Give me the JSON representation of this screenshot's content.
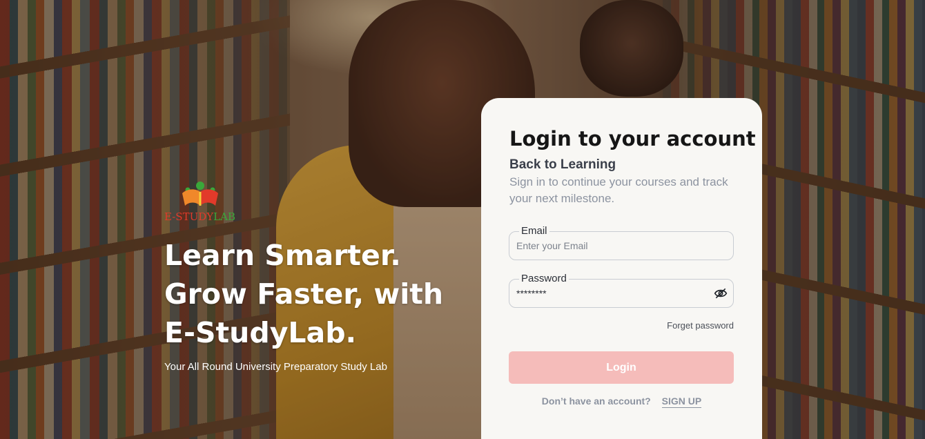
{
  "brand": {
    "logo_text_prefix": "E-STUDY",
    "logo_text_suffix": "LAB",
    "logo_color_primary": "#e23a2a",
    "logo_color_secondary": "#3aa83a"
  },
  "hero": {
    "line1": "Learn Smarter.",
    "line2": "Grow Faster, with",
    "line3": "E-StudyLab.",
    "tagline": "Your All Round University Preparatory Study Lab"
  },
  "login": {
    "title": "Login to your account",
    "subtitle": "Back to Learning",
    "description": "Sign in to continue your courses and track your next milestone.",
    "email_label": "Email",
    "email_placeholder": "Enter your Email",
    "password_label": "Password",
    "password_value": "********",
    "password_toggle_icon": "eye-off-icon",
    "forget_password": "Forget password",
    "login_button": "Login",
    "login_button_color": "#f5bcba",
    "signup_prompt": "Don’t have an account?",
    "signup_link": "SIGN UP"
  }
}
